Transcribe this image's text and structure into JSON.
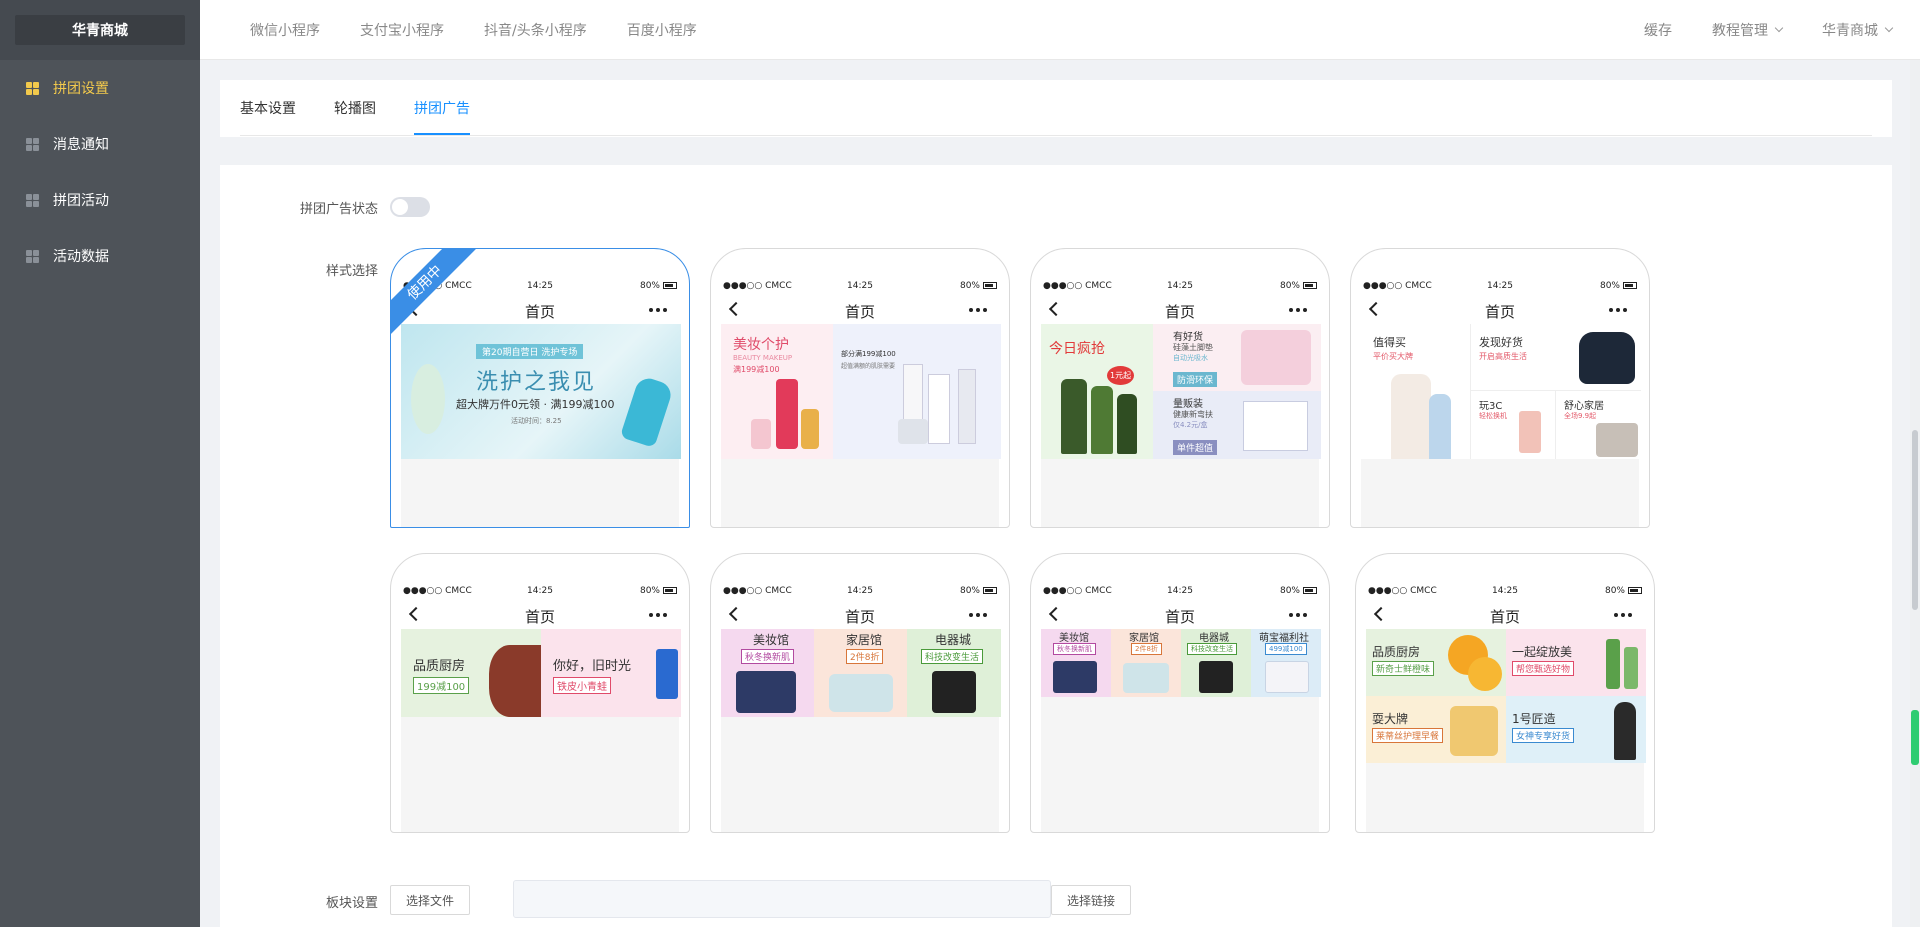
{
  "sidebar": {
    "brand": "华青商城",
    "items": [
      {
        "label": "拼团设置",
        "active": true
      },
      {
        "label": "消息通知"
      },
      {
        "label": "拼团活动"
      },
      {
        "label": "活动数据"
      }
    ]
  },
  "topbar": {
    "nav": [
      "微信小程序",
      "支付宝小程序",
      "抖音/头条小程序",
      "百度小程序"
    ],
    "right": {
      "cache": "缓存",
      "tutorial": "教程管理",
      "shop": "华青商城"
    }
  },
  "tabs": [
    "基本设置",
    "轮播图",
    "拼团广告"
  ],
  "active_tab": "拼团广告",
  "form": {
    "status_label": "拼团广告状态",
    "status_on": false,
    "style_label": "样式选择",
    "block_label": "板块设置",
    "choose_file": "选择文件",
    "choose_link": "选择链接",
    "link_value": ""
  },
  "phone_common": {
    "carrier": "●●●○○ CMCC",
    "time": "14:25",
    "battery": "80%",
    "title": "首页"
  },
  "styles": {
    "in_use_badge": "使用中",
    "s1": {
      "headline": "洗护之我见",
      "sub": "超大牌万件0元领 · 满199减100",
      "top": "第20期自营日 洗护专场",
      "tiny": "活动时间：8.25"
    },
    "s2": {
      "title": "美妆个护",
      "en": "BEAUTY MAKEUP",
      "promo": "满199减100",
      "right_title": "部分满199减100",
      "right_sub": "超值满额的肌肤需要"
    },
    "s3": {
      "title": "今日疯抢",
      "price": "1元起",
      "b1": "有好货",
      "b1s": "硅藻土脚垫",
      "b1t": "自动光吸水",
      "b1tag": "防滑环保",
      "b2": "量贩装",
      "b2s": "健康新弯扶",
      "b2t": "仅4.2元/盒",
      "b2tag": "单件超值"
    },
    "s4": {
      "a": "值得买",
      "as": "平价买大牌",
      "b": "发现好货",
      "bs": "开启高质生活",
      "c": "玩3C",
      "cs": "轻松换机",
      "d": "舒心家居",
      "ds": "全场9.9起"
    },
    "s5": {
      "a": "品质厨房",
      "at": "199减100",
      "b": "你好，旧时光",
      "bt": "铁皮小青蛙"
    },
    "s6": {
      "a": "美妆馆",
      "at": "秋冬换新肌",
      "b": "家居馆",
      "bt": "2件8折",
      "c": "电器城",
      "ct": "科技改变生活"
    },
    "s7": {
      "a": "美妆馆",
      "at": "秋冬换新肌",
      "b": "家居馆",
      "bt": "2件8折",
      "c": "电器城",
      "ct": "科技改变生活",
      "d": "萌宝福利社",
      "dt": "499减100"
    },
    "s8": {
      "a": "品质厨房",
      "at": "新奇士鲜橙味",
      "b": "一起绽放美",
      "bt": "帮您甄选好物",
      "c": "耍大牌",
      "ct": "莱蒂丝护理早餐",
      "d": "1号匠造",
      "dt": "女神专享好货"
    }
  },
  "colors": {
    "accent": "#1890ff",
    "sidebar": "#4e5359",
    "active_menu": "#f2c94c",
    "badge": "#3a8ee6"
  }
}
